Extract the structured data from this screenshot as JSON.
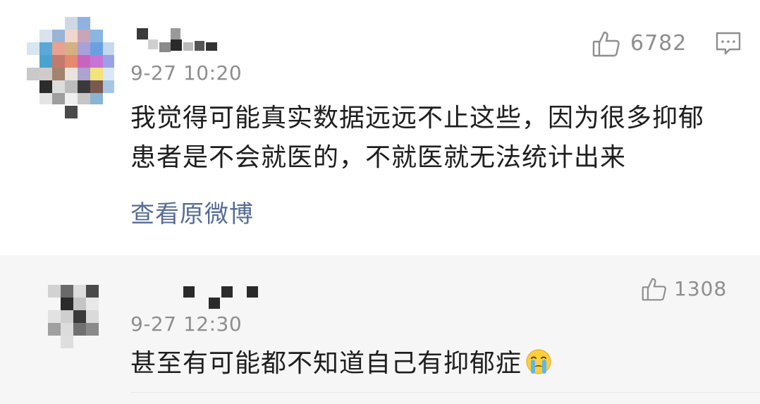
{
  "comments": [
    {
      "time": "9-27 10:20",
      "text_line1": "我觉得可能真实数据远远不止这些，因为很多抑郁",
      "text_line2": "患者是不会就医的，不就医就无法统计出来",
      "view_original": "查看原微博",
      "likes": "6782",
      "icons": {
        "like": "thumbs-up-icon",
        "reply": "comment-icon"
      }
    },
    {
      "time": "9-27 12:30",
      "text": "甚至有可能都不知道自己有抑郁症",
      "emoji": "crying-face-emoji",
      "likes": "1308",
      "icons": {
        "like": "thumbs-up-icon"
      }
    }
  ]
}
